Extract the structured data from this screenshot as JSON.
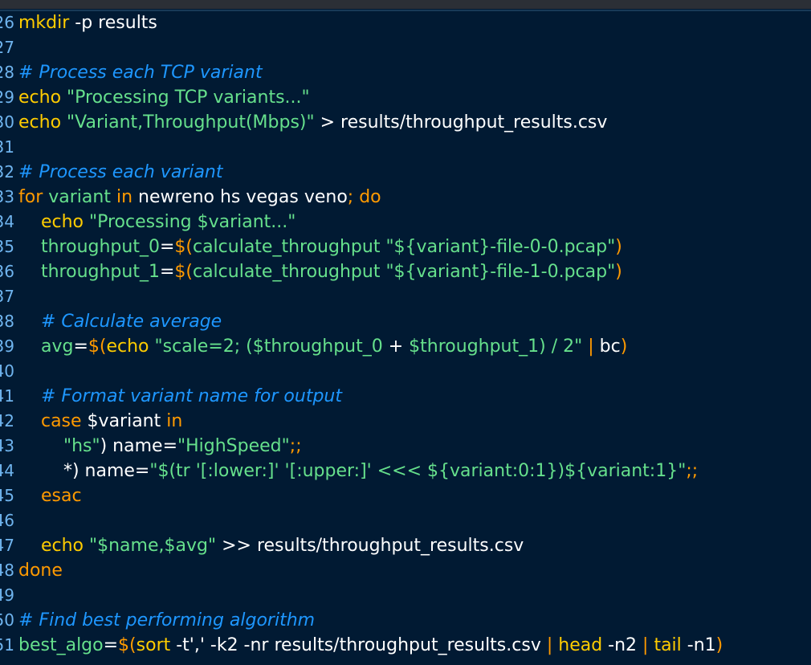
{
  "colors": {
    "background": "#011a33",
    "keyword": "#ff9a00",
    "command": "#ffcc00",
    "string": "#66e08c",
    "plain": "#ffffff",
    "comment": "#1e97ff",
    "line_number": "#6fb4ee"
  },
  "lines": [
    {
      "num": "26",
      "tokens": [
        {
          "t": "mkdir",
          "c": "y"
        },
        {
          "t": " -p results",
          "c": "w"
        }
      ]
    },
    {
      "num": "27",
      "tokens": []
    },
    {
      "num": "28",
      "tokens": [
        {
          "t": "# Process each TCP variant",
          "c": "c"
        }
      ]
    },
    {
      "num": "29",
      "tokens": [
        {
          "t": "echo ",
          "c": "y"
        },
        {
          "t": "\"Processing TCP variants...\"",
          "c": "g"
        }
      ]
    },
    {
      "num": "30",
      "tokens": [
        {
          "t": "echo ",
          "c": "y"
        },
        {
          "t": "\"Variant,Throughput(Mbps)\"",
          "c": "g"
        },
        {
          "t": " > results/throughput_results.csv",
          "c": "w"
        }
      ]
    },
    {
      "num": "31",
      "tokens": []
    },
    {
      "num": "32",
      "tokens": [
        {
          "t": "# Process each variant",
          "c": "c"
        }
      ]
    },
    {
      "num": "33",
      "tokens": [
        {
          "t": "for ",
          "c": "o"
        },
        {
          "t": "variant",
          "c": "g"
        },
        {
          "t": " in ",
          "c": "o"
        },
        {
          "t": "newreno hs vegas veno",
          "c": "w"
        },
        {
          "t": "; do",
          "c": "o"
        }
      ]
    },
    {
      "num": "34",
      "tokens": [
        {
          "t": "    echo ",
          "c": "y"
        },
        {
          "t": "\"Processing $variant...\"",
          "c": "g"
        }
      ]
    },
    {
      "num": "35",
      "tokens": [
        {
          "t": "    throughput_0",
          "c": "g"
        },
        {
          "t": "=",
          "c": "w"
        },
        {
          "t": "$(",
          "c": "o"
        },
        {
          "t": "calculate_throughput ",
          "c": "g"
        },
        {
          "t": "\"${variant}-file-0-0.pcap\"",
          "c": "g"
        },
        {
          "t": ")",
          "c": "o"
        }
      ]
    },
    {
      "num": "36",
      "tokens": [
        {
          "t": "    throughput_1",
          "c": "g"
        },
        {
          "t": "=",
          "c": "w"
        },
        {
          "t": "$(",
          "c": "o"
        },
        {
          "t": "calculate_throughput ",
          "c": "g"
        },
        {
          "t": "\"${variant}-file-1-0.pcap\"",
          "c": "g"
        },
        {
          "t": ")",
          "c": "o"
        }
      ]
    },
    {
      "num": "37",
      "tokens": []
    },
    {
      "num": "38",
      "tokens": [
        {
          "t": "    # Calculate average",
          "c": "c"
        }
      ]
    },
    {
      "num": "39",
      "tokens": [
        {
          "t": "    avg",
          "c": "g"
        },
        {
          "t": "=",
          "c": "w"
        },
        {
          "t": "$(",
          "c": "o"
        },
        {
          "t": "echo ",
          "c": "y"
        },
        {
          "t": "\"scale=2; (",
          "c": "g"
        },
        {
          "t": "$throughput_0",
          "c": "g"
        },
        {
          "t": " + ",
          "c": "w"
        },
        {
          "t": "$throughput_1",
          "c": "g"
        },
        {
          "t": ") / 2\"",
          "c": "g"
        },
        {
          "t": " | ",
          "c": "o"
        },
        {
          "t": "bc",
          "c": "w"
        },
        {
          "t": ")",
          "c": "o"
        }
      ]
    },
    {
      "num": "40",
      "tokens": []
    },
    {
      "num": "41",
      "tokens": [
        {
          "t": "    # Format variant name for output",
          "c": "c"
        }
      ]
    },
    {
      "num": "42",
      "tokens": [
        {
          "t": "    case ",
          "c": "o"
        },
        {
          "t": "$variant",
          "c": "w"
        },
        {
          "t": " in",
          "c": "o"
        }
      ]
    },
    {
      "num": "43",
      "tokens": [
        {
          "t": "        \"hs\"",
          "c": "g"
        },
        {
          "t": ") ",
          "c": "w"
        },
        {
          "t": "name",
          "c": "w"
        },
        {
          "t": "=",
          "c": "w"
        },
        {
          "t": "\"HighSpeed\"",
          "c": "g"
        },
        {
          "t": ";;",
          "c": "o"
        }
      ]
    },
    {
      "num": "44",
      "tokens": [
        {
          "t": "        *) ",
          "c": "w"
        },
        {
          "t": "name",
          "c": "w"
        },
        {
          "t": "=",
          "c": "w"
        },
        {
          "t": "\"$(tr '[:lower:]' '[:upper:]' <<< ${variant:0:1})${variant:1}\"",
          "c": "g"
        },
        {
          "t": ";;",
          "c": "o"
        }
      ]
    },
    {
      "num": "45",
      "tokens": [
        {
          "t": "    esac",
          "c": "o"
        }
      ]
    },
    {
      "num": "46",
      "tokens": []
    },
    {
      "num": "47",
      "tokens": [
        {
          "t": "    echo ",
          "c": "y"
        },
        {
          "t": "\"$name,$avg\"",
          "c": "g"
        },
        {
          "t": " >> results/throughput_results.csv",
          "c": "w"
        }
      ]
    },
    {
      "num": "48",
      "tokens": [
        {
          "t": "done",
          "c": "o"
        }
      ]
    },
    {
      "num": "49",
      "tokens": []
    },
    {
      "num": "50",
      "tokens": [
        {
          "t": "# Find best performing algorithm",
          "c": "c"
        }
      ]
    },
    {
      "num": "51",
      "tokens": [
        {
          "t": "best_algo",
          "c": "g"
        },
        {
          "t": "=",
          "c": "w"
        },
        {
          "t": "$(",
          "c": "o"
        },
        {
          "t": "sort ",
          "c": "y"
        },
        {
          "t": "-t','",
          "c": "w"
        },
        {
          "t": " -k2 -nr results/throughput_results.csv ",
          "c": "w"
        },
        {
          "t": "| ",
          "c": "o"
        },
        {
          "t": "head ",
          "c": "y"
        },
        {
          "t": "-n2 ",
          "c": "w"
        },
        {
          "t": "| ",
          "c": "o"
        },
        {
          "t": "tail ",
          "c": "y"
        },
        {
          "t": "-n1",
          "c": "w"
        },
        {
          "t": ")",
          "c": "o"
        }
      ]
    }
  ]
}
